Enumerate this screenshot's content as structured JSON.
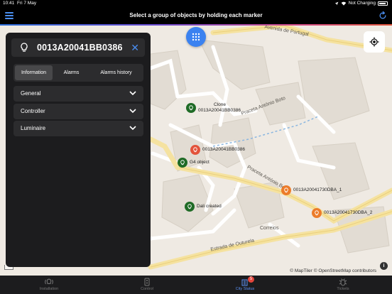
{
  "status_bar": {
    "time": "10:41",
    "date": "Fri 7 May",
    "charging": "Not Charging"
  },
  "header": {
    "title": "Select a group of objects by holding each marker",
    "menu_icon": "hamburger-icon",
    "refresh_icon": "refresh-icon"
  },
  "panel": {
    "object_name": "0013A20041BB0386",
    "tabs": [
      {
        "label": "Information",
        "active": true
      },
      {
        "label": "Alarms",
        "active": false
      },
      {
        "label": "Alarms history",
        "active": false
      }
    ],
    "sections": [
      {
        "label": "General"
      },
      {
        "label": "Controller"
      },
      {
        "label": "Luminaire"
      }
    ]
  },
  "map": {
    "markers": [
      {
        "label_line1": "Clone",
        "label_line2": "0013A20041BB0386",
        "color": "#1f6b26"
      },
      {
        "label_line1": "0013A20041BB0386",
        "color": "#e3533b"
      },
      {
        "label_line1": "G4 object",
        "color": "#1f6b26"
      },
      {
        "label_line1": "0013A20041730DBA_1",
        "color": "#ec7c2b"
      },
      {
        "label_line1": "Dali created",
        "color": "#1f6b26"
      },
      {
        "label_line1": "0013A20041730DBA_2",
        "color": "#ec7c2b"
      }
    ],
    "streets": [
      "Avenida de Portugal",
      "Praceta António Boto",
      "Praceta António Boto",
      "Estrada de Outurela",
      "Correios"
    ],
    "attribution": "© MapTiler © OpenStreetMap contributors",
    "info_label": "i"
  },
  "tab_bar": {
    "tabs": [
      {
        "label": "Installation",
        "active": false
      },
      {
        "label": "Control",
        "active": false
      },
      {
        "label": "City Status",
        "active": true,
        "badge": "5"
      },
      {
        "label": "Tickets",
        "active": false
      }
    ]
  },
  "colors": {
    "accent": "#4a8ef0",
    "panel_bg": "#1c1c1e",
    "map_bg": "#efeae3",
    "road": "#f5e2a0"
  }
}
